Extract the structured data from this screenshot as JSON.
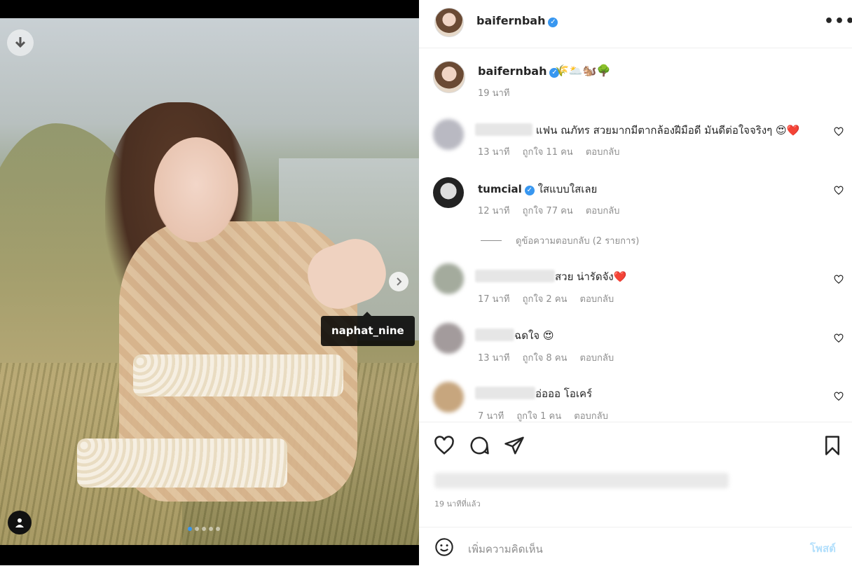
{
  "media": {
    "tag_username": "naphat_nine",
    "carousel_count": 5,
    "carousel_active_index": 0
  },
  "header": {
    "username": "baifernbah",
    "more_label": "•••"
  },
  "caption": {
    "username": "baifernbah",
    "emojis": "🌾🌥️🐿️🌳",
    "time": "19 นาที"
  },
  "comments": [
    {
      "text": "แฟน ณภัทร สวยมากมีตากล้องฝีมือดี มันดีต่อใจจริงๆ 😍❤️",
      "time": "13 นาที",
      "likes": "ถูกใจ 11 คน",
      "reply": "ตอบกลับ"
    },
    {
      "username": "tumcial",
      "text": "ใสแบบใสเลย",
      "time": "12 นาที",
      "likes": "ถูกใจ 77 คน",
      "reply": "ตอบกลับ"
    },
    {
      "text": "สวย น่ารัดจัง❤️",
      "time": "17 นาที",
      "likes": "ถูกใจ 2 คน",
      "reply": "ตอบกลับ"
    },
    {
      "text": "ฉดใจ 😍",
      "time": "13 นาที",
      "likes": "ถูกใจ 8 คน",
      "reply": "ตอบกลับ"
    },
    {
      "text": "อ่อออ โอเคร์",
      "time": "7 นาที",
      "likes": "ถูกใจ 1 คน",
      "reply": "ตอบกลับ"
    }
  ],
  "view_replies": "ดูข้อความตอบกลับ (2 รายการ)",
  "post_time": "19 นาทีที่แล้ว",
  "add_comment": {
    "placeholder": "เพิ่มความคิดเห็น",
    "post_label": "โพสต์"
  },
  "icons": {
    "download": "download-icon",
    "next": "chevron-right-icon",
    "user_tag": "user-icon",
    "like": "heart-icon",
    "comment": "comment-icon",
    "share": "share-icon",
    "save": "bookmark-icon",
    "emoji": "emoji-icon"
  },
  "colors": {
    "verified": "#3897f0",
    "post_button": "#b2dffc",
    "muted_text": "#8e8e8e"
  }
}
